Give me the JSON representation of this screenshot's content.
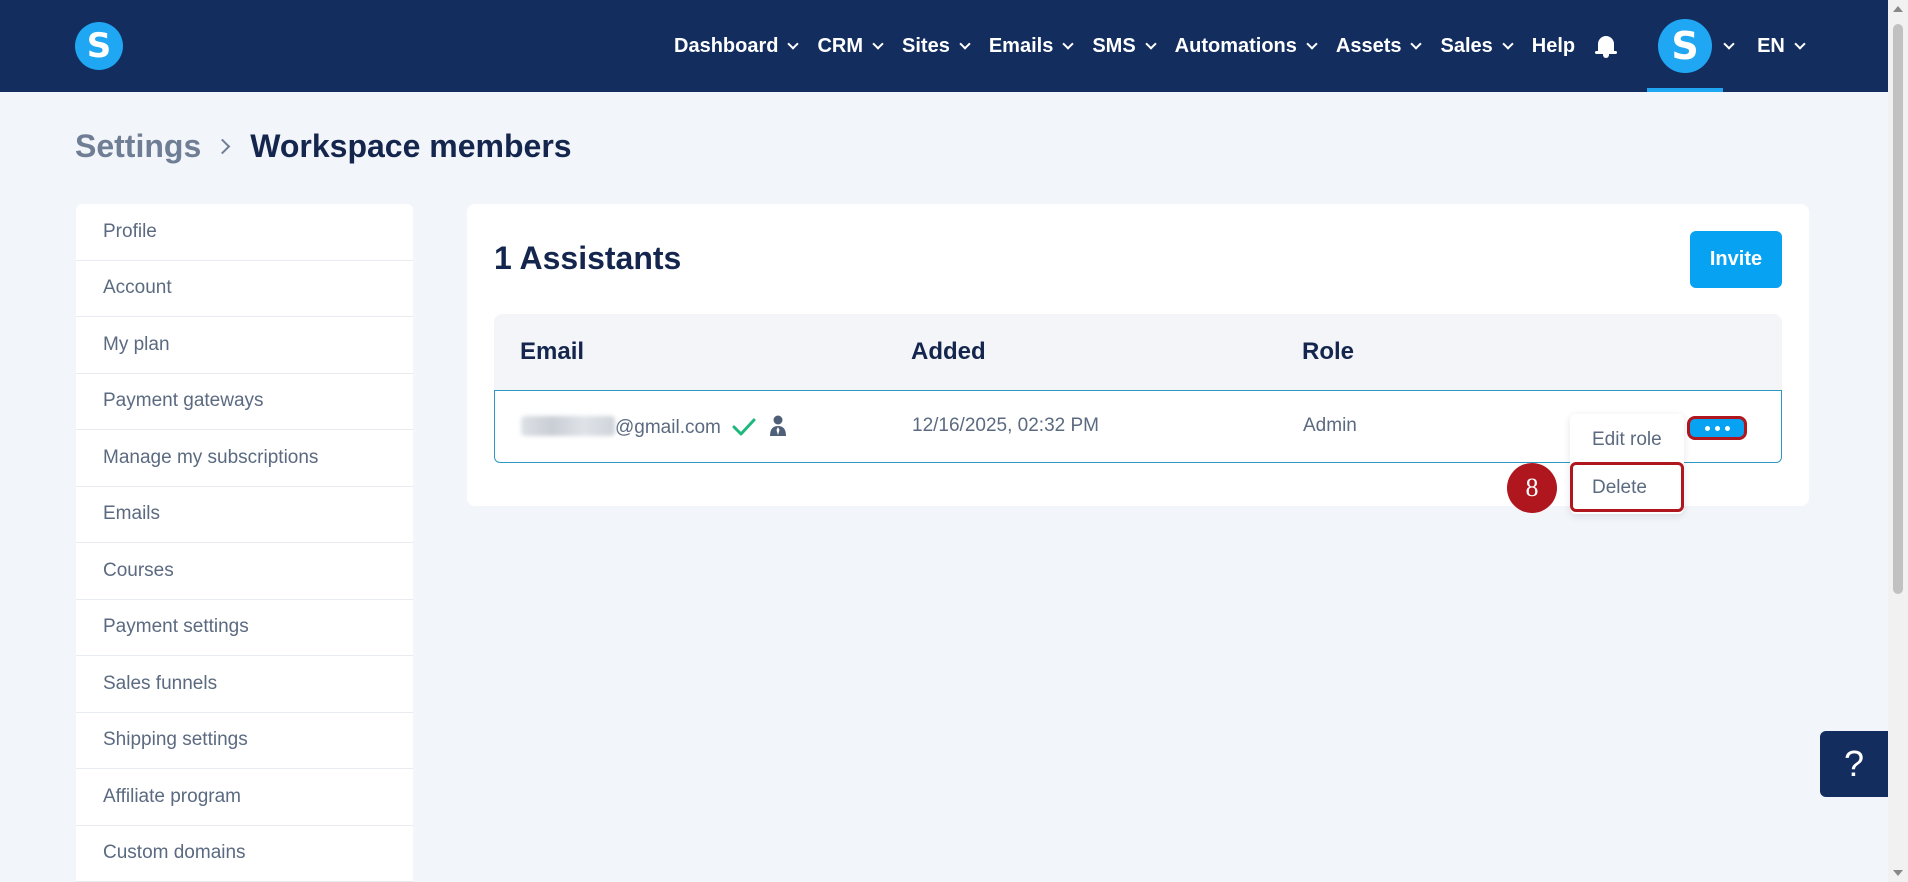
{
  "app": {
    "logo_letter": "S",
    "avatar_letter": "S",
    "brand_color": "#1fa7f3",
    "nav_bg_color": "#132d5e"
  },
  "nav": {
    "items": [
      {
        "label": "Dashboard",
        "has_dropdown": true
      },
      {
        "label": "CRM",
        "has_dropdown": true
      },
      {
        "label": "Sites",
        "has_dropdown": true
      },
      {
        "label": "Emails",
        "has_dropdown": true
      },
      {
        "label": "SMS",
        "has_dropdown": true
      },
      {
        "label": "Automations",
        "has_dropdown": true
      },
      {
        "label": "Assets",
        "has_dropdown": true
      },
      {
        "label": "Sales",
        "has_dropdown": true
      },
      {
        "label": "Help",
        "has_dropdown": false
      }
    ],
    "bell_icon": "bell-icon",
    "language": "EN"
  },
  "breadcrumb": {
    "parent": "Settings",
    "current": "Workspace members"
  },
  "sidebar": {
    "items": [
      "Profile",
      "Account",
      "My plan",
      "Payment gateways",
      "Manage my subscriptions",
      "Emails",
      "Courses",
      "Payment settings",
      "Sales funnels",
      "Shipping settings",
      "Affiliate program",
      "Custom domains"
    ]
  },
  "members": {
    "title": "1 Assistants",
    "invite_label": "Invite",
    "columns": [
      "Email",
      "Added",
      "Role"
    ],
    "rows": [
      {
        "email_domain": "@gmail.com",
        "added": "12/16/2025, 02:32 PM",
        "role": "Admin"
      }
    ]
  },
  "row_menu": {
    "items": [
      "Edit role",
      "Delete"
    ]
  },
  "annotation": {
    "step": "8",
    "color": "#b0161d"
  },
  "help_button": {
    "label": "?"
  }
}
